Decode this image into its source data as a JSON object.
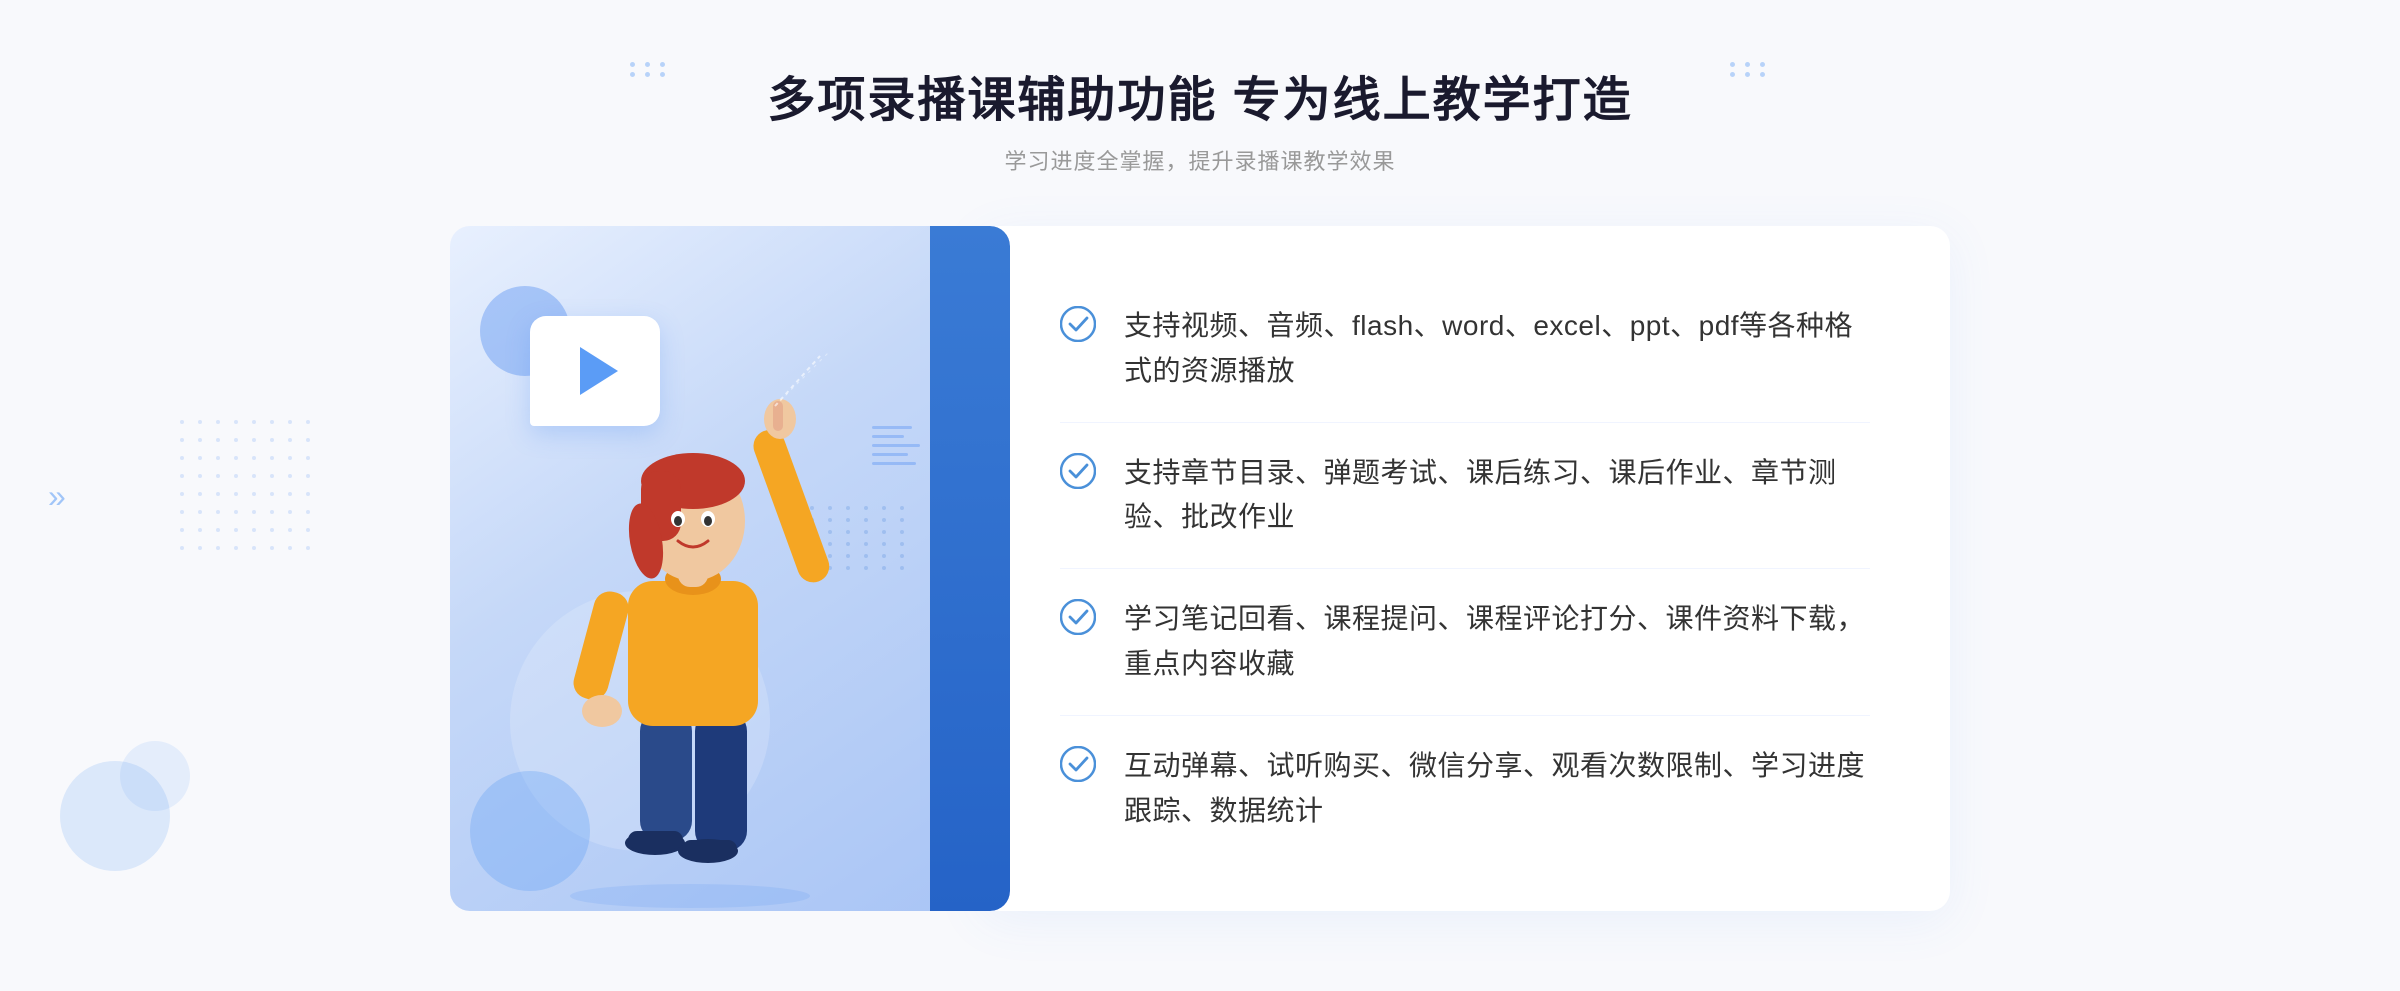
{
  "header": {
    "title": "多项录播课辅助功能 专为线上教学打造",
    "subtitle": "学习进度全掌握，提升录播课教学效果"
  },
  "features": [
    {
      "id": "feature-1",
      "text": "支持视频、音频、flash、word、excel、ppt、pdf等各种格式的资源播放"
    },
    {
      "id": "feature-2",
      "text": "支持章节目录、弹题考试、课后练习、课后作业、章节测验、批改作业"
    },
    {
      "id": "feature-3",
      "text": "学习笔记回看、课程提问、课程评论打分、课件资料下载，重点内容收藏"
    },
    {
      "id": "feature-4",
      "text": "互动弹幕、试听购买、微信分享、观看次数限制、学习进度跟踪、数据统计"
    }
  ],
  "colors": {
    "accent": "#3a7bd5",
    "accent_light": "#5b9cf6",
    "text_dark": "#1a1a2e",
    "text_grey": "#999999",
    "text_body": "#333333",
    "check_color": "#4a90d9",
    "bg": "#f8f9fc"
  },
  "decorations": {
    "chevrons": "»",
    "play_label": "play"
  }
}
